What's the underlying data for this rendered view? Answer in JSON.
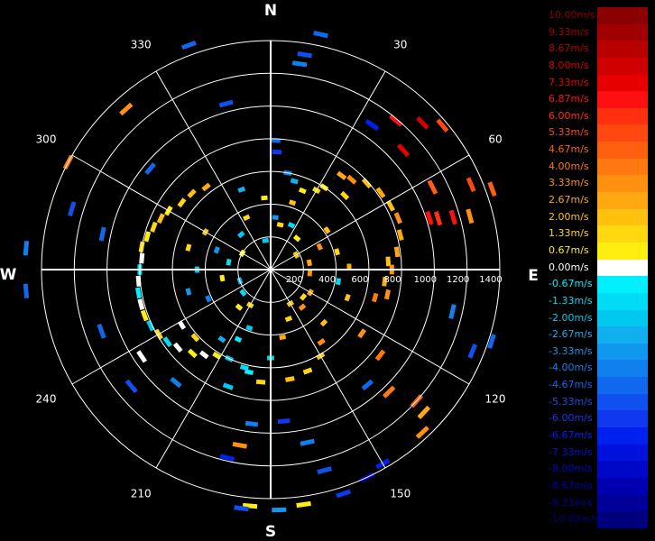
{
  "chart_data": {
    "type": "polar-velocity",
    "cardinals": {
      "north": "N",
      "east": "E",
      "south": "S",
      "west": "W"
    },
    "angle_labels": [
      {
        "bearing": 30,
        "text": "30"
      },
      {
        "bearing": 60,
        "text": "60"
      },
      {
        "bearing": 120,
        "text": "120"
      },
      {
        "bearing": 150,
        "text": "150"
      },
      {
        "bearing": 210,
        "text": "210"
      },
      {
        "bearing": 240,
        "text": "240"
      },
      {
        "bearing": 300,
        "text": "300"
      },
      {
        "bearing": 330,
        "text": "330"
      }
    ],
    "range_rings": [
      200,
      400,
      600,
      800,
      1000,
      1200,
      1400
    ],
    "range_max": 1400,
    "grid": true,
    "legend": {
      "placement": "right",
      "entries": [
        {
          "label": "10.00m/s",
          "value": 10.0,
          "color": "#8b0000",
          "text_color": "#8b0000"
        },
        {
          "label": "9.33m/s",
          "value": 9.33,
          "color": "#a00000",
          "text_color": "#a00000"
        },
        {
          "label": "8.67m/s",
          "value": 8.67,
          "color": "#b80000",
          "text_color": "#b80000"
        },
        {
          "label": "8.00m/s",
          "value": 8.0,
          "color": "#d00000",
          "text_color": "#d00000"
        },
        {
          "label": "7.33m/s",
          "value": 7.33,
          "color": "#e60000",
          "text_color": "#e60000"
        },
        {
          "label": "6.87m/s",
          "value": 6.87,
          "color": "#ff1010",
          "text_color": "#ff1010"
        },
        {
          "label": "6.00m/s",
          "value": 6.0,
          "color": "#ff3010",
          "text_color": "#ff3010"
        },
        {
          "label": "5.33m/s",
          "value": 5.33,
          "color": "#ff4810",
          "text_color": "#ff4810"
        },
        {
          "label": "4.67m/s",
          "value": 4.67,
          "color": "#ff6010",
          "text_color": "#ff6010"
        },
        {
          "label": "4.00m/s",
          "value": 4.0,
          "color": "#ff7810",
          "text_color": "#ff7810"
        },
        {
          "label": "3.33m/s",
          "value": 3.33,
          "color": "#ff9010",
          "text_color": "#ff9010"
        },
        {
          "label": "2.67m/s",
          "value": 2.67,
          "color": "#ffa810",
          "text_color": "#ffa810"
        },
        {
          "label": "2.00m/s",
          "value": 2.0,
          "color": "#ffc010",
          "text_color": "#ffc010"
        },
        {
          "label": "1.33m/s",
          "value": 1.33,
          "color": "#ffd810",
          "text_color": "#ffd810"
        },
        {
          "label": "0.67m/s",
          "value": 0.67,
          "color": "#ffee10",
          "text_color": "#ffee10"
        },
        {
          "label": "0.00m/s",
          "value": 0.0,
          "color": "#ffffff",
          "text_color": "#ffffff"
        },
        {
          "label": "-0.67m/s",
          "value": -0.67,
          "color": "#00f0ff",
          "text_color": "#00f0ff"
        },
        {
          "label": "-1.33m/s",
          "value": -1.33,
          "color": "#00dcf5",
          "text_color": "#00dcf5"
        },
        {
          "label": "-2.00m/s",
          "value": -2.0,
          "color": "#00c8ee",
          "text_color": "#00c8ee"
        },
        {
          "label": "-2.67m/s",
          "value": -2.67,
          "color": "#10b0ee",
          "text_color": "#10b0ee"
        },
        {
          "label": "-3.33m/s",
          "value": -3.33,
          "color": "#1098ee",
          "text_color": "#1098ee"
        },
        {
          "label": "-4.00m/s",
          "value": -4.0,
          "color": "#1080ee",
          "text_color": "#1080ee"
        },
        {
          "label": "-4.67m/s",
          "value": -4.67,
          "color": "#1068ee",
          "text_color": "#1068ee"
        },
        {
          "label": "-5.33m/s",
          "value": -5.33,
          "color": "#1050ee",
          "text_color": "#1050ee"
        },
        {
          "label": "-6.00m/s",
          "value": -6.0,
          "color": "#1038ee",
          "text_color": "#1038ee"
        },
        {
          "label": "-6.67m/s",
          "value": -6.67,
          "color": "#0020ee",
          "text_color": "#0020ee"
        },
        {
          "label": "-7.33m/s",
          "value": -7.33,
          "color": "#0010dd",
          "text_color": "#0010dd"
        },
        {
          "label": "-8.00m/s",
          "value": -8.0,
          "color": "#0008c8",
          "text_color": "#0008c8"
        },
        {
          "label": "-8.67m/s",
          "value": -8.67,
          "color": "#0000b0",
          "text_color": "#0000b0"
        },
        {
          "label": "-9.33m/s",
          "value": -9.33,
          "color": "#000098",
          "text_color": "#000098"
        },
        {
          "label": "-10.00m/s",
          "value": -10.0,
          "color": "#00007e",
          "text_color": "#00007e"
        }
      ]
    },
    "gates": [
      {
        "az": 12,
        "range": 1470,
        "v": -4.67
      },
      {
        "az": 9,
        "range": 1330,
        "v": -5.33
      },
      {
        "az": 8,
        "range": 1270,
        "v": -4.0
      },
      {
        "az": 2,
        "range": 790,
        "v": -4.67
      },
      {
        "az": 3,
        "range": 720,
        "v": -6.0
      },
      {
        "az": 35,
        "range": 1080,
        "v": -6.67
      },
      {
        "az": 40,
        "range": 1190,
        "v": 6.87
      },
      {
        "az": 46,
        "range": 1290,
        "v": 8.0
      },
      {
        "az": 50,
        "range": 1370,
        "v": 5.33
      },
      {
        "az": 48,
        "range": 1090,
        "v": 7.33
      },
      {
        "az": 63,
        "range": 1110,
        "v": 4.67
      },
      {
        "az": 67,
        "range": 1330,
        "v": 5.33
      },
      {
        "az": 70,
        "range": 1440,
        "v": 4.67
      },
      {
        "az": 72,
        "range": 1020,
        "v": 6.87
      },
      {
        "az": 73,
        "range": 1070,
        "v": 6.0
      },
      {
        "az": 74,
        "range": 1160,
        "v": 6.87
      },
      {
        "az": 75,
        "range": 1260,
        "v": 3.33
      },
      {
        "az": 37,
        "range": 720,
        "v": 2.67
      },
      {
        "az": 42,
        "range": 740,
        "v": 3.33
      },
      {
        "az": 48,
        "range": 790,
        "v": 2.0
      },
      {
        "az": 55,
        "range": 820,
        "v": 2.67
      },
      {
        "az": 62,
        "range": 830,
        "v": 2.0
      },
      {
        "az": 68,
        "range": 840,
        "v": 3.33
      },
      {
        "az": 75,
        "range": 820,
        "v": 2.67
      },
      {
        "az": 82,
        "range": 780,
        "v": 2.67
      },
      {
        "az": 86,
        "range": 720,
        "v": 2.0
      },
      {
        "az": 90,
        "range": 740,
        "v": 3.33
      },
      {
        "az": 96,
        "range": 700,
        "v": 2.67
      },
      {
        "az": 102,
        "range": 730,
        "v": 3.33
      },
      {
        "az": 105,
        "range": 660,
        "v": 4.0
      },
      {
        "az": 30,
        "range": 560,
        "v": 1.33
      },
      {
        "az": 33,
        "range": 600,
        "v": 0.67
      },
      {
        "az": 45,
        "range": 640,
        "v": 1.33
      },
      {
        "az": 55,
        "range": 420,
        "v": 2.0
      },
      {
        "az": 65,
        "range": 330,
        "v": 3.33
      },
      {
        "az": 80,
        "range": 240,
        "v": 2.67
      },
      {
        "az": 95,
        "range": 240,
        "v": 3.33
      },
      {
        "az": 103,
        "range": 1140,
        "v": -4.0
      },
      {
        "az": 108,
        "range": 1420,
        "v": -4.67
      },
      {
        "az": 112,
        "range": 1330,
        "v": -5.33
      },
      {
        "az": 132,
        "range": 1200,
        "v": 4.67
      },
      {
        "az": 133,
        "range": 1280,
        "v": 2.67
      },
      {
        "az": 137,
        "range": 1360,
        "v": 3.33
      },
      {
        "az": 136,
        "range": 1040,
        "v": 4.0
      },
      {
        "az": 128,
        "range": 850,
        "v": 4.0
      },
      {
        "az": 125,
        "range": 680,
        "v": 3.33
      },
      {
        "az": 140,
        "range": 920,
        "v": -4.67
      },
      {
        "az": 150,
        "range": 1370,
        "v": -6.67
      },
      {
        "az": 155,
        "range": 1400,
        "v": -8.0
      },
      {
        "az": 162,
        "range": 1440,
        "v": -6.0
      },
      {
        "az": 165,
        "range": 1270,
        "v": -5.33
      },
      {
        "az": 168,
        "range": 1080,
        "v": -4.0
      },
      {
        "az": 175,
        "range": 930,
        "v": -6.0
      },
      {
        "az": 172,
        "range": 1450,
        "v": 0.67
      },
      {
        "az": 178,
        "range": 1470,
        "v": -3.33
      },
      {
        "az": 185,
        "range": 1450,
        "v": 0.67
      },
      {
        "az": 187,
        "range": 1470,
        "v": -5.33
      },
      {
        "az": 190,
        "range": 1090,
        "v": 3.33
      },
      {
        "az": 193,
        "range": 1180,
        "v": -6.67
      },
      {
        "az": 187,
        "range": 950,
        "v": -4.0
      },
      {
        "az": 200,
        "range": 760,
        "v": -2.0
      },
      {
        "az": 195,
        "range": 620,
        "v": -1.33
      },
      {
        "az": 150,
        "range": 610,
        "v": 2.0
      },
      {
        "az": 160,
        "range": 660,
        "v": 1.33
      },
      {
        "az": 170,
        "range": 680,
        "v": 2.0
      },
      {
        "az": 185,
        "range": 690,
        "v": 1.33
      },
      {
        "az": 192,
        "range": 640,
        "v": -0.67
      },
      {
        "az": 205,
        "range": 600,
        "v": -2.0
      },
      {
        "az": 212,
        "range": 620,
        "v": 0.67
      },
      {
        "az": 218,
        "range": 660,
        "v": 0.0
      },
      {
        "az": 223,
        "range": 700,
        "v": 0.67
      },
      {
        "az": 230,
        "range": 740,
        "v": 0.0
      },
      {
        "az": 235,
        "range": 770,
        "v": -1.33
      },
      {
        "az": 240,
        "range": 790,
        "v": 1.33
      },
      {
        "az": 245,
        "range": 810,
        "v": -2.0
      },
      {
        "az": 250,
        "range": 820,
        "v": 0.67
      },
      {
        "az": 255,
        "range": 820,
        "v": 0.0
      },
      {
        "az": 260,
        "range": 820,
        "v": -0.67
      },
      {
        "az": 265,
        "range": 810,
        "v": 0.0
      },
      {
        "az": 270,
        "range": 800,
        "v": -1.33
      },
      {
        "az": 275,
        "range": 790,
        "v": 0.0
      },
      {
        "az": 280,
        "range": 800,
        "v": 1.33
      },
      {
        "az": 285,
        "range": 780,
        "v": 0.67
      },
      {
        "az": 290,
        "range": 760,
        "v": 1.33
      },
      {
        "az": 295,
        "range": 740,
        "v": 2.0
      },
      {
        "az": 300,
        "range": 720,
        "v": 0.67
      },
      {
        "az": 307,
        "range": 680,
        "v": 1.33
      },
      {
        "az": 314,
        "range": 670,
        "v": 2.0
      },
      {
        "az": 322,
        "range": 640,
        "v": 2.67
      },
      {
        "az": 228,
        "range": 620,
        "v": 1.33
      },
      {
        "az": 238,
        "range": 640,
        "v": 0.0
      },
      {
        "az": 215,
        "range": 520,
        "v": -2.67
      },
      {
        "az": 220,
        "range": 900,
        "v": -4.0
      },
      {
        "az": 230,
        "range": 1110,
        "v": -5.33
      },
      {
        "az": 236,
        "range": 950,
        "v": 0.0
      },
      {
        "az": 250,
        "range": 1100,
        "v": -4.67
      },
      {
        "az": 282,
        "range": 1050,
        "v": -4.67
      },
      {
        "az": 287,
        "range": 1270,
        "v": -5.33
      },
      {
        "az": 275,
        "range": 1500,
        "v": -4.0
      },
      {
        "az": 265,
        "range": 1500,
        "v": -4.67
      },
      {
        "az": 298,
        "range": 1400,
        "v": 4.0
      },
      {
        "az": 310,
        "range": 960,
        "v": -4.67
      },
      {
        "az": 318,
        "range": 1320,
        "v": 3.33
      },
      {
        "az": 340,
        "range": 1460,
        "v": -4.67
      },
      {
        "az": 345,
        "range": 1050,
        "v": -5.33
      },
      {
        "az": 350,
        "range": 180,
        "v": -2.0
      },
      {
        "az": 5,
        "range": 320,
        "v": -3.33
      },
      {
        "az": 12,
        "range": 280,
        "v": 1.33
      },
      {
        "az": 18,
        "range": 430,
        "v": 2.0
      },
      {
        "az": 22,
        "range": 520,
        "v": 0.67
      },
      {
        "az": 15,
        "range": 560,
        "v": -2.67
      },
      {
        "az": 10,
        "range": 600,
        "v": -4.0
      },
      {
        "az": 25,
        "range": 300,
        "v": -1.33
      },
      {
        "az": 120,
        "range": 280,
        "v": 2.67
      },
      {
        "az": 130,
        "range": 260,
        "v": 1.33
      },
      {
        "az": 140,
        "range": 300,
        "v": 3.33
      },
      {
        "az": 150,
        "range": 240,
        "v": 2.0
      },
      {
        "az": 160,
        "range": 320,
        "v": 1.33
      },
      {
        "az": 170,
        "range": 420,
        "v": 2.67
      },
      {
        "az": 200,
        "range": 380,
        "v": -2.0
      },
      {
        "az": 210,
        "range": 250,
        "v": 1.33
      },
      {
        "az": 220,
        "range": 300,
        "v": 0.67
      },
      {
        "az": 230,
        "range": 220,
        "v": -1.33
      },
      {
        "az": 250,
        "range": 200,
        "v": -2.67
      },
      {
        "az": 260,
        "range": 300,
        "v": 0.67
      },
      {
        "az": 280,
        "range": 260,
        "v": -1.33
      },
      {
        "az": 290,
        "range": 350,
        "v": -3.33
      },
      {
        "az": 300,
        "range": 200,
        "v": 0.67
      },
      {
        "az": 320,
        "range": 280,
        "v": -2.0
      },
      {
        "az": 335,
        "range": 350,
        "v": 1.33
      },
      {
        "az": 100,
        "range": 420,
        "v": -1.33
      },
      {
        "az": 110,
        "range": 500,
        "v": 2.0
      },
      {
        "az": 60,
        "range": 180,
        "v": 2.0
      },
      {
        "az": 40,
        "range": 250,
        "v": 0.67
      },
      {
        "az": 75,
        "range": 420,
        "v": 1.33
      },
      {
        "az": 88,
        "range": 480,
        "v": 2.67
      },
      {
        "az": 135,
        "range": 460,
        "v": 2.0
      },
      {
        "az": 145,
        "range": 540,
        "v": 3.33
      },
      {
        "az": 180,
        "range": 540,
        "v": -1.33
      },
      {
        "az": 205,
        "range": 470,
        "v": -0.67
      },
      {
        "az": 245,
        "range": 420,
        "v": -4.0
      },
      {
        "az": 255,
        "range": 520,
        "v": -3.33
      },
      {
        "az": 270,
        "range": 450,
        "v": -2.0
      },
      {
        "az": 285,
        "range": 520,
        "v": 1.33
      },
      {
        "az": 300,
        "range": 460,
        "v": 2.0
      },
      {
        "az": 340,
        "range": 520,
        "v": -2.67
      },
      {
        "az": 355,
        "range": 440,
        "v": 0.67
      }
    ]
  }
}
